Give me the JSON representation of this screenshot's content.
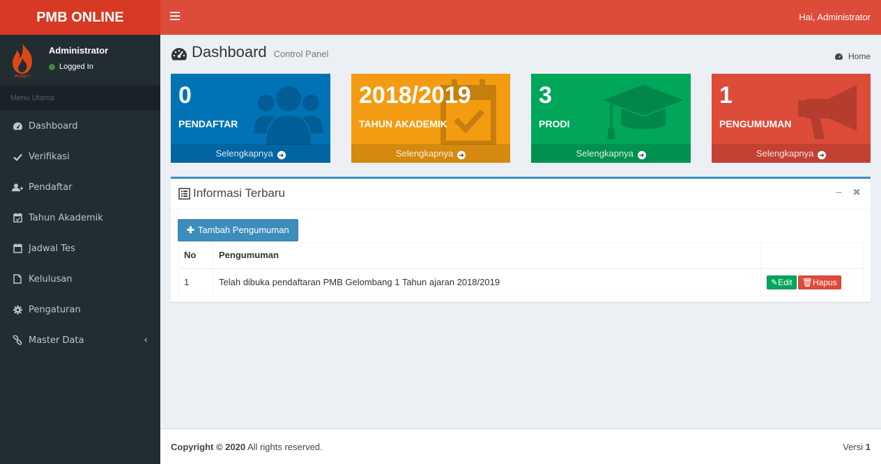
{
  "app": {
    "logo_text": "PMB ONLINE",
    "greeting": "Hai, Administrator"
  },
  "user": {
    "name": "Administrator",
    "status": "Logged In",
    "status_color": "#3c8d3c"
  },
  "sidebar": {
    "header": "Menu Utama",
    "items": [
      {
        "label": "Dashboard",
        "icon": "dashboard-icon"
      },
      {
        "label": "Verifikasi",
        "icon": "check-icon"
      },
      {
        "label": "Pendaftar",
        "icon": "user-plus-icon"
      },
      {
        "label": "Tahun Akademik",
        "icon": "calendar-check-icon"
      },
      {
        "label": "Jadwal Tes",
        "icon": "calendar-icon"
      },
      {
        "label": "Kelulusan",
        "icon": "file-icon"
      },
      {
        "label": "Pengaturan",
        "icon": "gear-icon"
      },
      {
        "label": "Master Data",
        "icon": "link-icon"
      }
    ]
  },
  "page": {
    "title": "Dashboard",
    "subtitle": "Control Panel",
    "breadcrumb": "Home"
  },
  "stats": [
    {
      "value": "0",
      "label": "PENDAFTAR",
      "more": "Selengkapnya",
      "color": "#0073b7",
      "icon": "users-icon"
    },
    {
      "value": "2018/2019",
      "label": "TAHUN AKADEMIK",
      "more": "Selengkapnya",
      "color": "#f39c12",
      "icon": "calendar-check-icon"
    },
    {
      "value": "3",
      "label": "PRODI",
      "more": "Selengkapnya",
      "color": "#00a65a",
      "icon": "graduation-cap-icon"
    },
    {
      "value": "1",
      "label": "PENGUMUMAN",
      "more": "Selengkapnya",
      "color": "#dd4b39",
      "icon": "bullhorn-icon"
    }
  ],
  "info_box": {
    "title": "Informasi Terbaru",
    "add_button": "Tambah Pengumuman",
    "columns": [
      "No",
      "Pengumuman",
      ""
    ],
    "rows": [
      {
        "no": "1",
        "text": "Telah dibuka pendaftaran PMB Gelombang 1 Tahun ajaran 2018/2019",
        "edit": "Edit",
        "delete": "Hapus"
      }
    ]
  },
  "footer": {
    "copyright_bold": "Copyright © 2020",
    "copyright_rest": " All rights reserved.",
    "version_label": "Versi ",
    "version": "1"
  }
}
